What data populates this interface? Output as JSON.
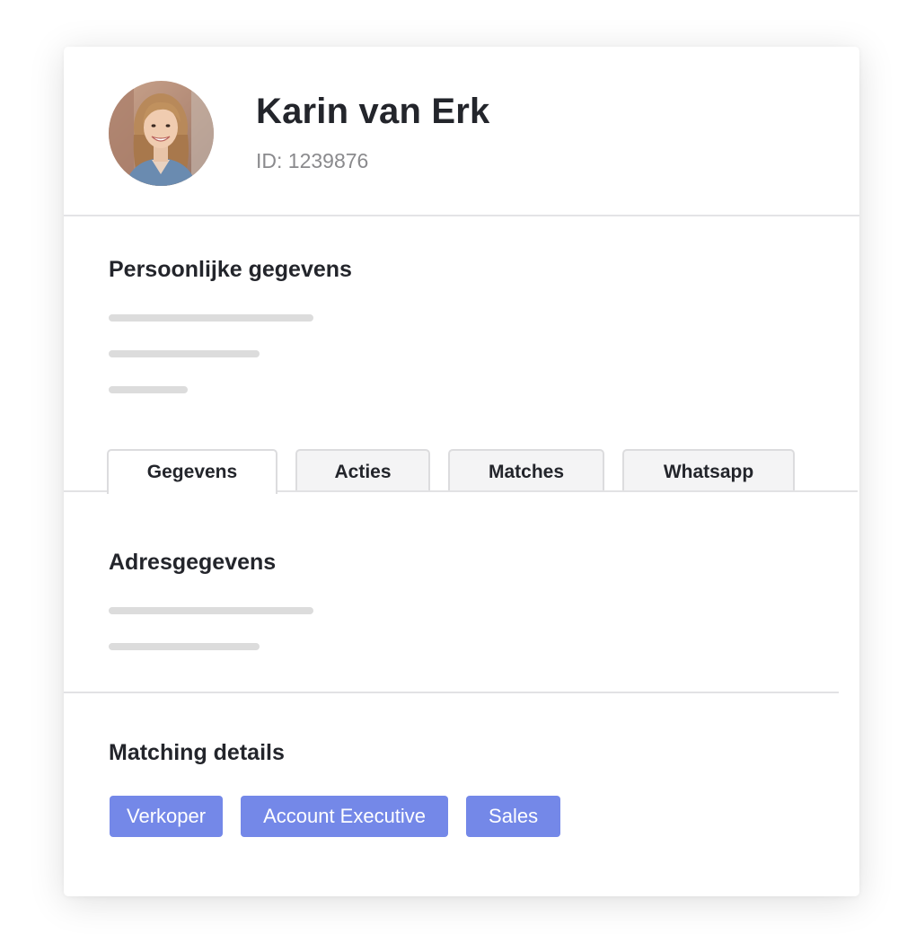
{
  "profile": {
    "name": "Karin van Erk",
    "id_label": "ID: 1239876",
    "avatar_icon": "profile-photo"
  },
  "personal": {
    "title": "Persoonlijke gegevens",
    "placeholder_lines": 3
  },
  "tabs": [
    {
      "label": "Gegevens",
      "active": true
    },
    {
      "label": "Acties",
      "active": false
    },
    {
      "label": "Matches",
      "active": false
    },
    {
      "label": "Whatsapp",
      "active": false
    }
  ],
  "address": {
    "title": "Adresgegevens",
    "placeholder_lines": 2
  },
  "matching": {
    "title": "Matching details",
    "tags": [
      "Verkoper",
      "Account Executive",
      "Sales"
    ]
  },
  "colors": {
    "tag_background": "#7488e8",
    "placeholder": "#dcdcdc",
    "text": "#23252b",
    "muted": "#8a8a8d"
  }
}
